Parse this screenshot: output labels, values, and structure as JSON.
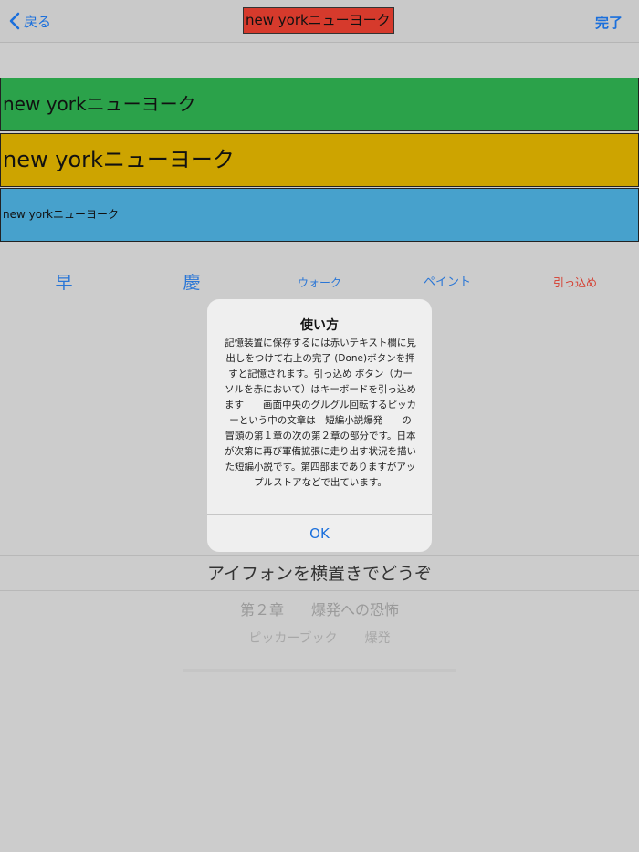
{
  "navbar": {
    "back_label": "戻る",
    "title_value": "new yorkニューヨーク",
    "done_label": "完了"
  },
  "bars": [
    {
      "text": "new yorkニューヨーク",
      "color": "#2ba24a"
    },
    {
      "text": "new yorkニューヨーク",
      "color": "#cda400"
    },
    {
      "text": "new yorkニューヨーク",
      "color": "#47a1cc"
    }
  ],
  "tools": [
    "早",
    "慶",
    "ウォーク",
    "ペイント",
    "引っ込め"
  ],
  "dialog": {
    "title": "使い方",
    "message": "記憶装置に保存するには赤いテキスト欄に見出しをつけて右上の完了 (Done)ボタンを押すと記憶されます。引っ込め ボタン（カーソルを赤において）はキーボードを引っ込めます　　画面中央のグルグル回転するピッカーという中の文章は　短編小説爆発　　の　冒頭の第１章の次の第２章の部分です。日本が次第に再び軍備拡張に走り出す状況を描いた短編小説です。第四部までありますがアップルストアなどで出ています。",
    "ok_label": "OK"
  },
  "picker": {
    "selected": "アイフォンを横置きでどうぞ",
    "row2": [
      "第２章",
      "爆発への恐怖"
    ],
    "row3": [
      "ピッカーブック",
      "爆発"
    ]
  }
}
